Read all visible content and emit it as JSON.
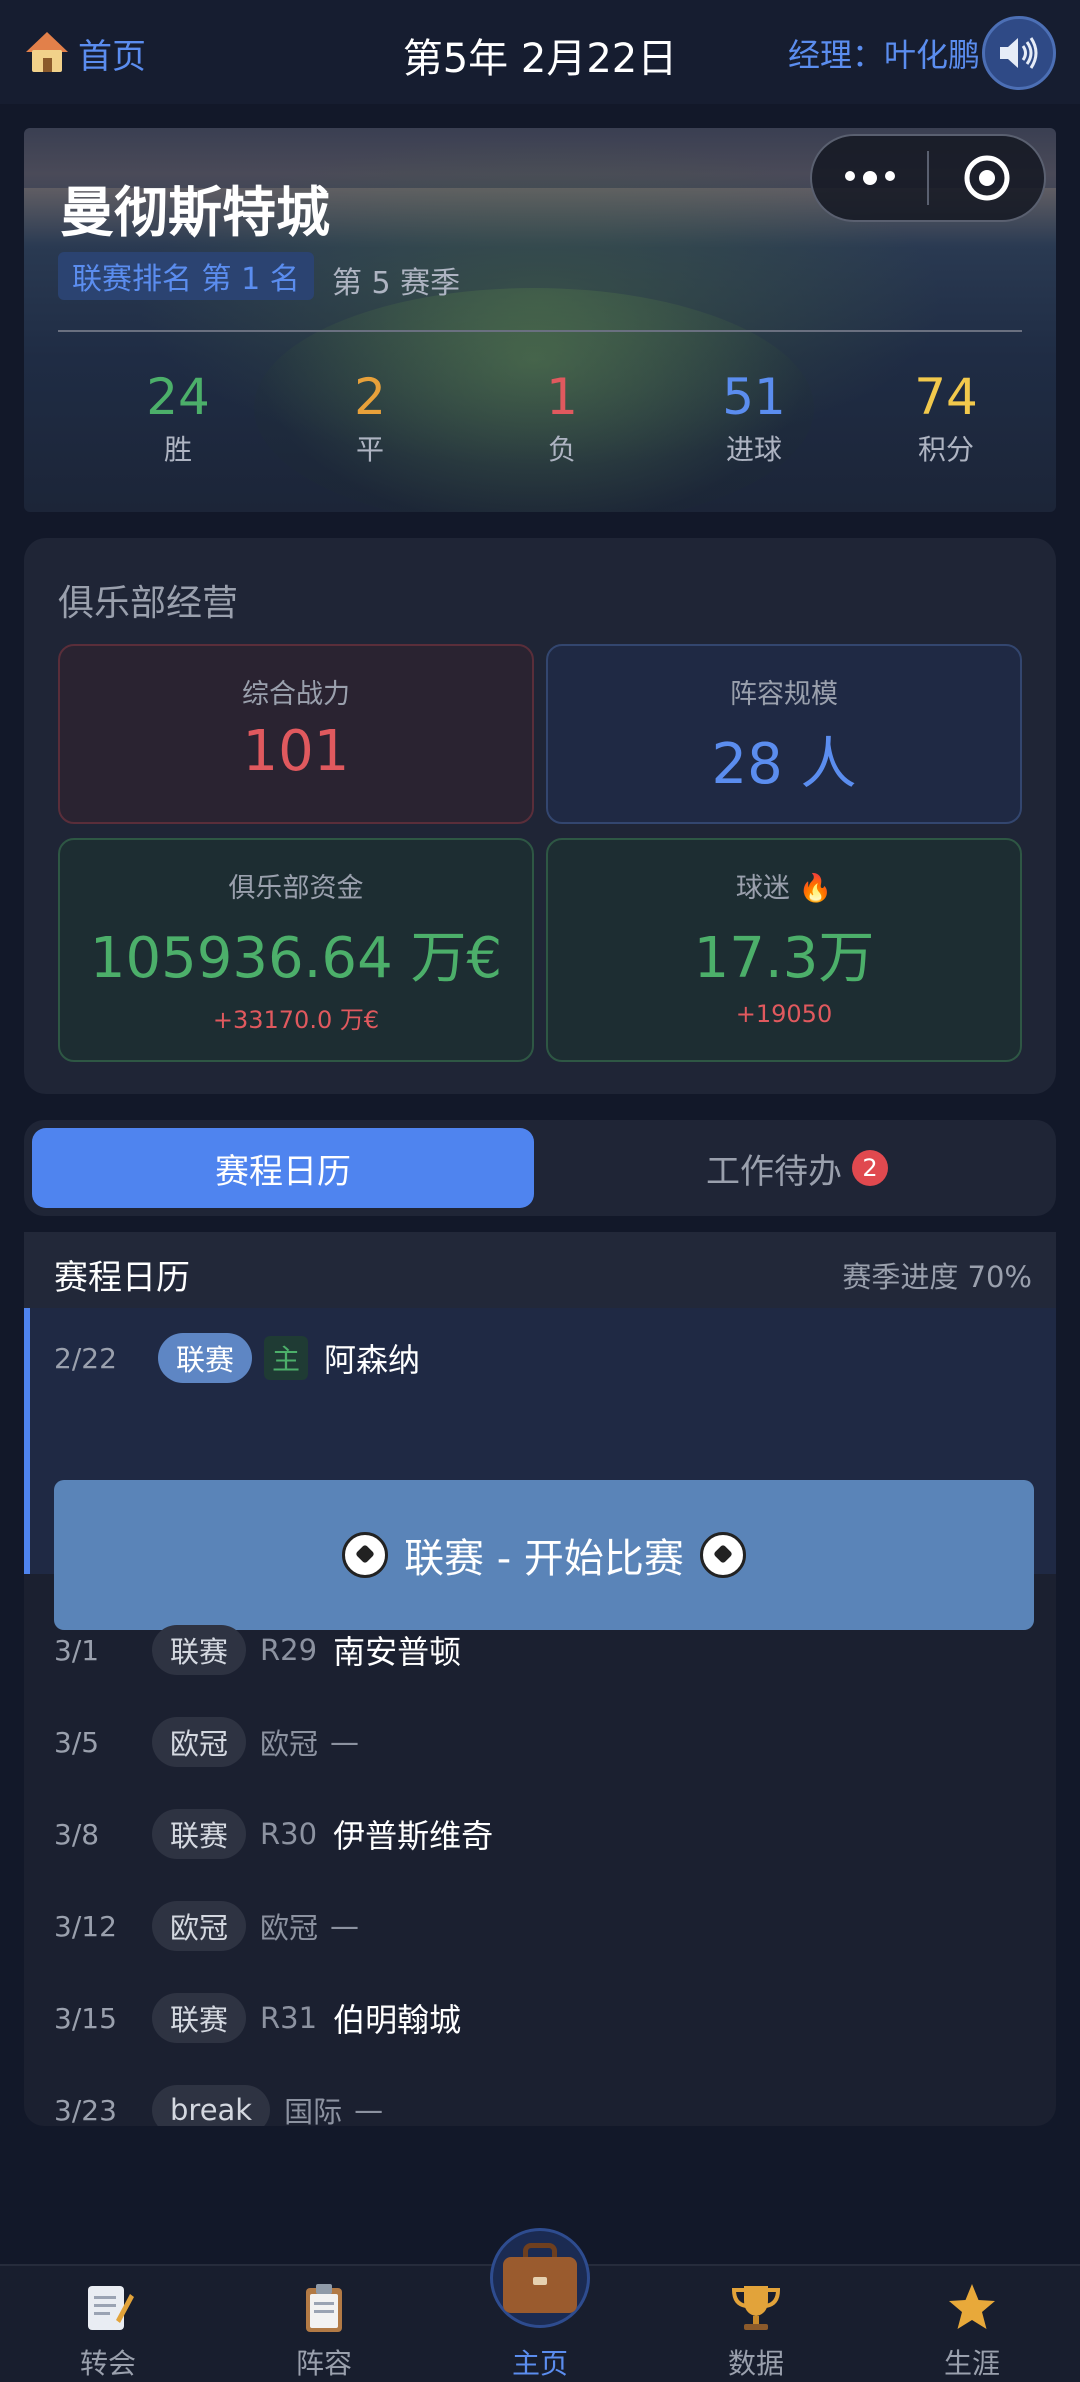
{
  "topbar": {
    "home_label": "首页",
    "date_label": "第5年 2月22日",
    "manager_label": "经理：叶化鹏"
  },
  "hero": {
    "team_name": "曼彻斯特城",
    "rank_label": "联赛排名 第 1 名",
    "season_label": "第 5 赛季",
    "stats": [
      {
        "value": "24",
        "label": "胜",
        "color": "#4caf6a"
      },
      {
        "value": "2",
        "label": "平",
        "color": "#e8a13a"
      },
      {
        "value": "1",
        "label": "负",
        "color": "#e0595e"
      },
      {
        "value": "51",
        "label": "进球",
        "color": "#5b8def"
      },
      {
        "value": "74",
        "label": "积分",
        "color": "#f2c94c"
      }
    ]
  },
  "management": {
    "title": "俱乐部经营",
    "power": {
      "label": "综合战力",
      "value": "101",
      "color": "#e0595e"
    },
    "squad": {
      "label": "阵容规模",
      "value": "28 人",
      "color": "#5b8def"
    },
    "funds": {
      "label": "俱乐部资金",
      "value": "105936.64 万€",
      "change": "+33170.0 万€",
      "color": "#4caf6a"
    },
    "fans": {
      "label": "球迷 🔥",
      "value": "17.3万",
      "change": "+19050",
      "color": "#4caf6a"
    }
  },
  "tabs": {
    "schedule": "赛程日历",
    "tasks": "工作待办",
    "tasks_badge": "2"
  },
  "schedule": {
    "title": "赛程日历",
    "progress": "赛季进度 70%",
    "current": {
      "date": "2/22",
      "type": "联赛",
      "venue": "主",
      "opponent": "阿森纳"
    },
    "start_button": "联赛 - 开始比赛",
    "upcoming": [
      {
        "date": "3/1",
        "type": "联赛",
        "round": "R29",
        "opponent": "南安普顿"
      },
      {
        "date": "3/5",
        "type": "欧冠",
        "round": "欧冠",
        "opponent": "—"
      },
      {
        "date": "3/8",
        "type": "联赛",
        "round": "R30",
        "opponent": "伊普斯维奇"
      },
      {
        "date": "3/12",
        "type": "欧冠",
        "round": "欧冠",
        "opponent": "—"
      },
      {
        "date": "3/15",
        "type": "联赛",
        "round": "R31",
        "opponent": "伯明翰城"
      },
      {
        "date": "3/23",
        "type": "break",
        "round": "国际",
        "opponent": "—"
      }
    ]
  },
  "nav": {
    "items": [
      {
        "label": "转会",
        "icon": "memo-icon"
      },
      {
        "label": "阵容",
        "icon": "clipboard-icon"
      },
      {
        "label": "主页",
        "icon": "briefcase-icon"
      },
      {
        "label": "数据",
        "icon": "trophy-icon"
      },
      {
        "label": "生涯",
        "icon": "star-icon"
      }
    ],
    "active_index": 2
  }
}
